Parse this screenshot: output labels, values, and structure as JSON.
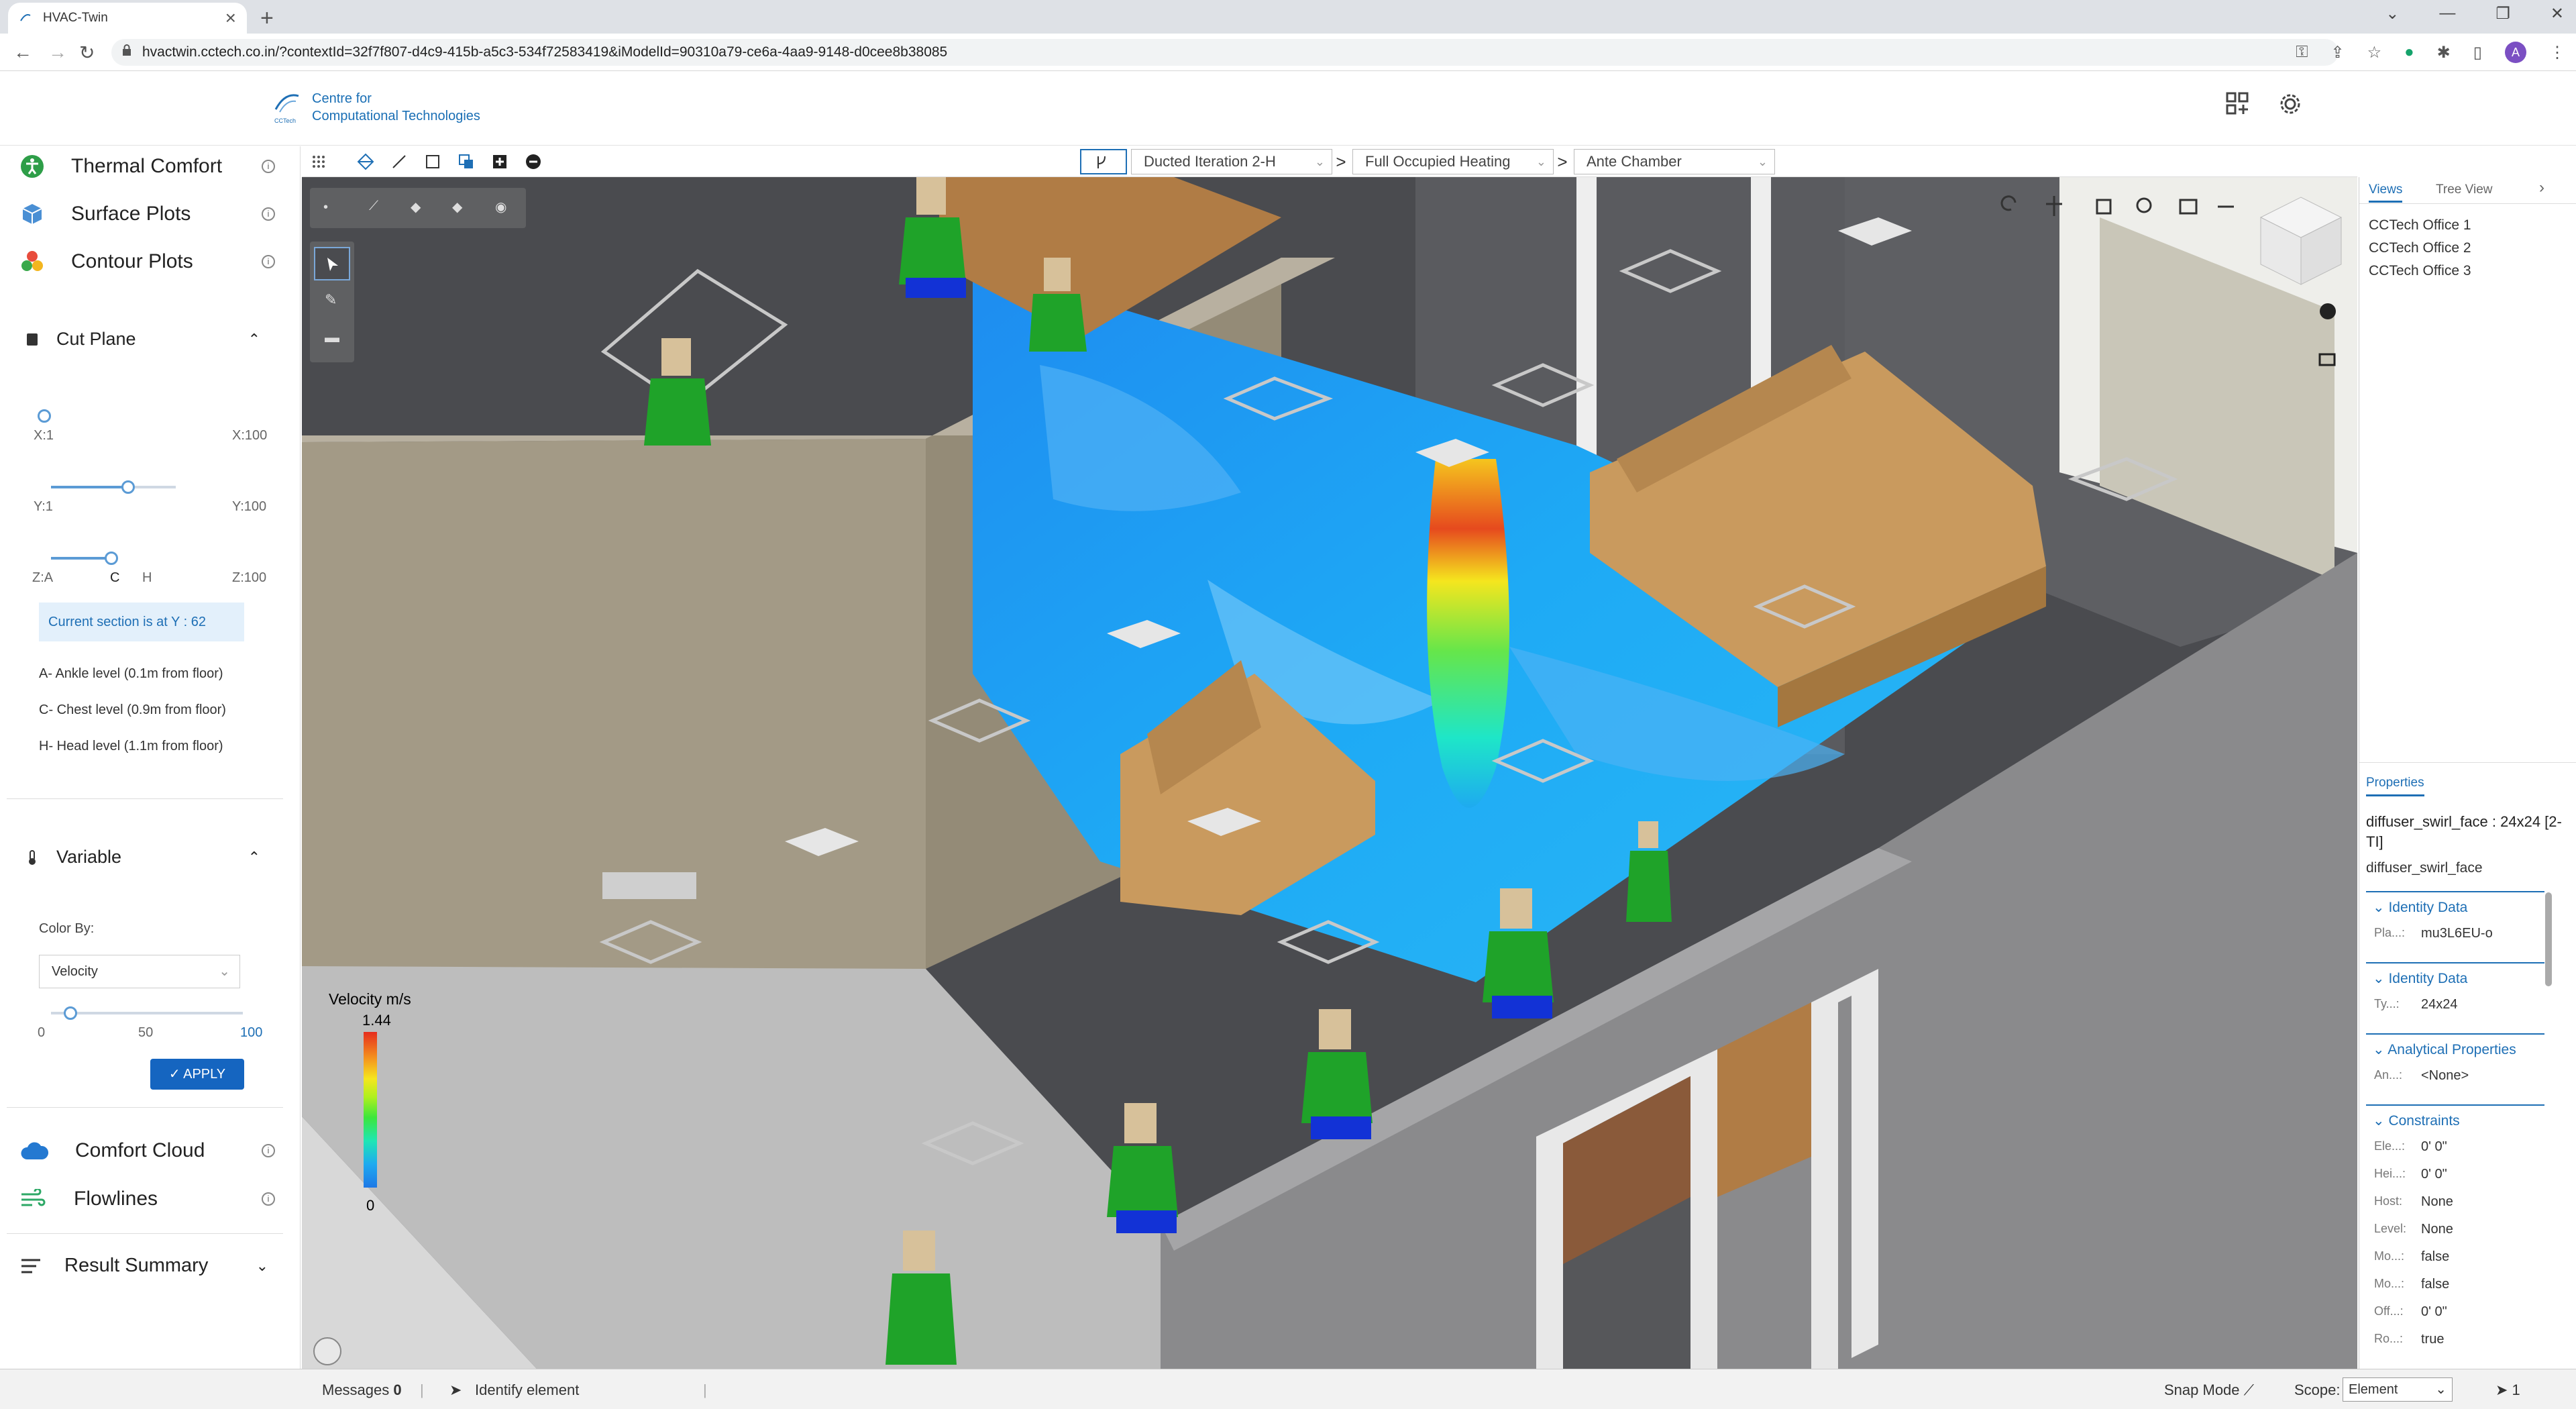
{
  "browser": {
    "tab_title": "HVAC-Twin",
    "new_tab": "+",
    "url": "hvactwin.cctech.co.in/?contextId=32f7f807-d4c9-415b-a5c3-534f72583419&iModelId=90310a79-ce6a-4aa9-9148-d0cee8b38085",
    "profile_initial": "A"
  },
  "header": {
    "logo_line1": "Centre for",
    "logo_line2": "Computational Technologies",
    "logo_small": "CCTech"
  },
  "sidebar": {
    "thermal_comfort": "Thermal Comfort",
    "surface_plots": "Surface Plots",
    "contour_plots": "Contour Plots",
    "cut_plane": "Cut Plane",
    "x_min": "X:1",
    "x_max": "X:100",
    "y_min": "Y:1",
    "y_max": "Y:100",
    "z_min": "Z:A",
    "z_c": "C",
    "z_h": "H",
    "z_max": "Z:100",
    "y_slider_value": 0.62,
    "z_slider_value": 0.5,
    "current_section": "Current section is at Y : 62",
    "level_a": "A- Ankle level (0.1m from floor)",
    "level_c": "C- Chest level (0.9m from floor)",
    "level_h": "H- Head level (1.1m from floor)",
    "variable": "Variable",
    "color_by_label": "Color By:",
    "color_by_value": "Velocity",
    "range_min": "0",
    "range_mid": "50",
    "range_max": "100",
    "range_slider_value": 0.1,
    "apply": "APPLY",
    "comfort_cloud": "Comfort Cloud",
    "flowlines": "Flowlines",
    "result_summary": "Result Summary"
  },
  "toolbar": {
    "iteration": "Ducted Iteration 2-H",
    "scenario": "Full Occupied Heating",
    "room": "Ante Chamber",
    "separator": ">"
  },
  "legend": {
    "title": "Velocity m/s",
    "max": "1.44",
    "min": "0"
  },
  "right_panel": {
    "tab_views": "Views",
    "tab_tree": "Tree View",
    "views": [
      "CCTech Office 1",
      "CCTech Office 2",
      "CCTech Office 3"
    ],
    "properties_tab": "Properties",
    "element_title": "diffuser_swirl_face : 24x24 [2-TI]",
    "element_name": "diffuser_swirl_face",
    "groups": [
      {
        "title": "Identity Data",
        "rows": [
          {
            "k": "Pla...:",
            "v": "mu3L6EU-o"
          }
        ]
      },
      {
        "title": "Identity Data",
        "rows": [
          {
            "k": "Ty...:",
            "v": "24x24"
          }
        ]
      },
      {
        "title": "Analytical Properties",
        "rows": [
          {
            "k": "An...:",
            "v": "<None>"
          }
        ]
      },
      {
        "title": "Constraints",
        "rows": [
          {
            "k": "Ele...:",
            "v": "0' 0\""
          },
          {
            "k": "Hei...:",
            "v": "0' 0\""
          },
          {
            "k": "Host:",
            "v": "None"
          },
          {
            "k": "Level:",
            "v": "None"
          },
          {
            "k": "Mo...:",
            "v": "false"
          },
          {
            "k": "Mo...:",
            "v": "false"
          },
          {
            "k": "Off...:",
            "v": "0' 0\""
          },
          {
            "k": "Ro...:",
            "v": "true"
          }
        ]
      }
    ]
  },
  "statusbar": {
    "messages": "Messages",
    "messages_count": "0",
    "identify": "Identify element",
    "snap_mode": "Snap Mode",
    "scope_label": "Scope:",
    "scope_value": "Element",
    "selection_count": "1"
  },
  "colors": {
    "accent": "#1e6fb5",
    "apply_button": "#1565c0",
    "floor": "#4a4b4f",
    "wall": "#a39a86"
  }
}
